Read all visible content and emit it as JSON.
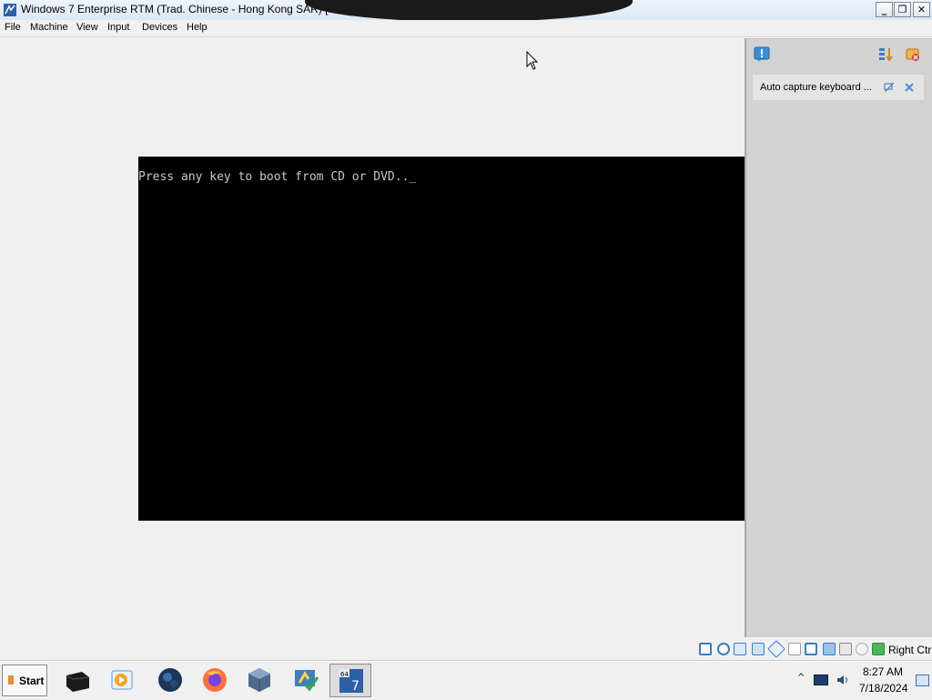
{
  "window": {
    "title": "Windows 7 Enterprise RTM (Trad. Chinese - Hong Kong SAR) [Running] - Oracle VM",
    "buttons": {
      "minimize": "_",
      "restore": "❐",
      "close": "✕"
    }
  },
  "menu": [
    "File",
    "Machine",
    "View",
    "Input",
    "Devices",
    "Help"
  ],
  "guest": {
    "console_text": "Press any key to boot from CD or DVD.._"
  },
  "notification_panel": {
    "message": "Auto capture keyboard ..."
  },
  "statusbar": {
    "host_key": "Right Ctrl"
  },
  "taskbar": {
    "start_label": "Start",
    "apps": [
      "terminal-icon",
      "media-player-icon",
      "globe-icon",
      "firefox-icon",
      "virtualbox-icon",
      "system-tool-icon",
      "windows7-vm-icon"
    ],
    "clock_time": "8:27 AM",
    "clock_date": "7/18/2024"
  }
}
